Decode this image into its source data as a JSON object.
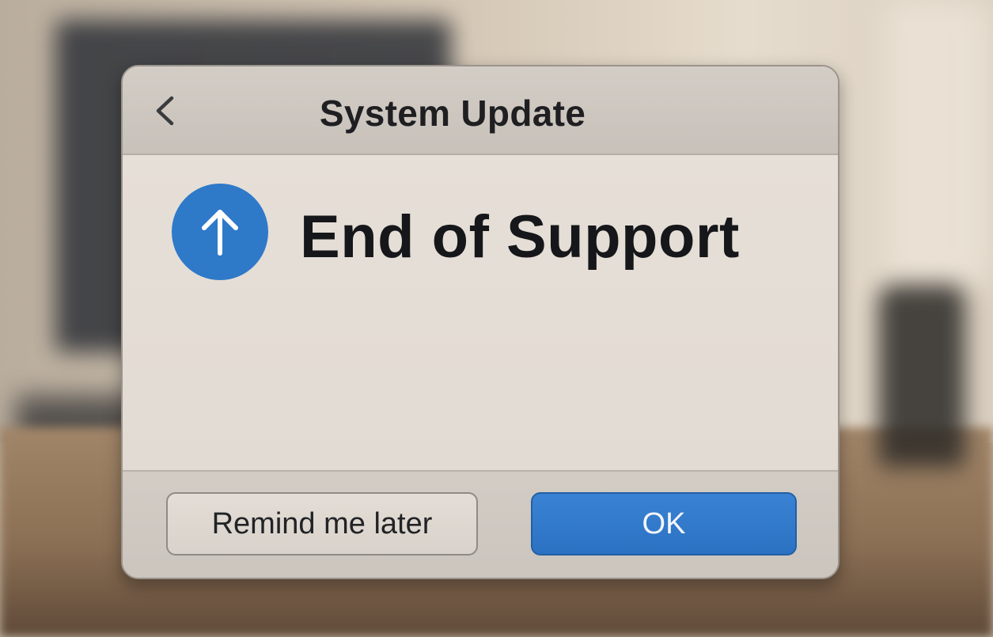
{
  "dialog": {
    "title": "System Update",
    "heading": "End of Support",
    "icons": {
      "back": "chevron-left-icon",
      "status": "arrow-up-circle-icon"
    },
    "buttons": {
      "secondary_label": "Remind me later",
      "primary_label": "OK"
    }
  },
  "colors": {
    "accent": "#2f79c9",
    "primary_button": "#2b72c3",
    "heading_text": "#16171a"
  }
}
